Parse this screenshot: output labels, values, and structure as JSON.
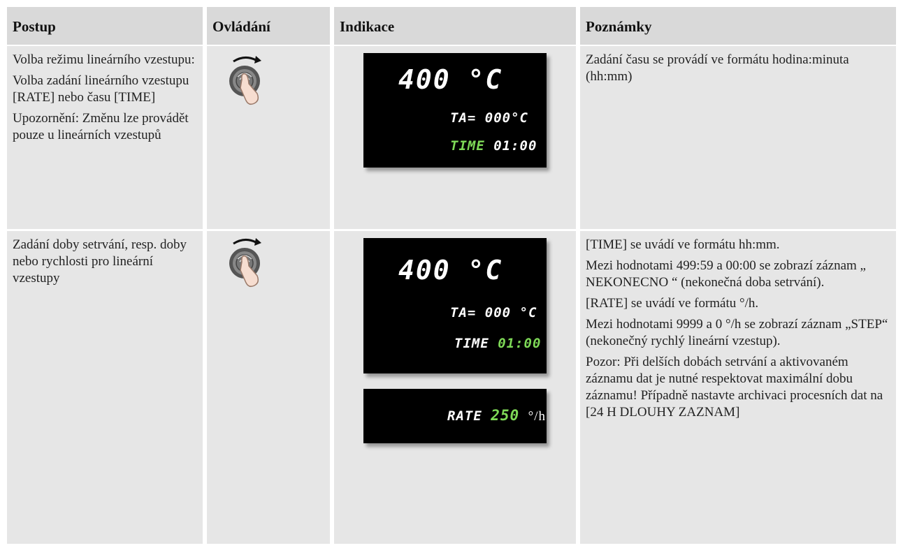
{
  "headers": [
    "Postup",
    "Ovládání",
    "Indikace",
    "Poznámky"
  ],
  "row1": {
    "procedure": [
      "Volba režimu lineárního vzestupu:",
      "Volba zadání lineárního vzestupu [RATE] nebo času [TIME]",
      "Upozornění: Změnu lze provádět pouze u lineárních vzestupů"
    ],
    "control_icon": "rotary-knob-turn-icon",
    "display": {
      "temp": "400",
      "temp_unit": "°C",
      "ta_label": "TA=",
      "ta_value": "000°C",
      "time_label": "TIME",
      "time_value": "01:00"
    },
    "notes": [
      "Zadání času se provádí ve formátu hodina:minuta (hh:mm)"
    ]
  },
  "row2": {
    "procedure": [
      "Zadání doby setrvání, resp. doby nebo rychlosti pro lineární vzestupy"
    ],
    "control_icon": "rotary-knob-turn-icon",
    "display": {
      "temp": "400",
      "temp_unit": "°C",
      "ta_label": "TA=",
      "ta_value": "000 °C",
      "time_label": "TIME",
      "time_value": "01:00"
    },
    "display_rate": {
      "rate_label": "RATE",
      "rate_value": "250",
      "rate_unit": "°/h"
    },
    "notes": [
      "[TIME] se uvádí ve formátu hh:mm.",
      "Mezi hodnotami 499:59 a 00:00 se zobrazí záznam „ NEKONECNO “ (nekonečná doba setrvání).",
      "[RATE] se uvádí ve formátu °/h.",
      "Mezi hodnotami 9999 a 0 °/h se zobrazí záznam „STEP“ (nekonečný rychlý lineární vzestup).",
      "Pozor: Při delších dobách setrvání a aktivovaném záznamu dat je nutné respektovat maximální dobu záznamu! Případně nastavte archivaci procesních dat na [24 H DLOUHY ZAZNAM]"
    ]
  },
  "colors": {
    "header_bg": "#d9d9d9",
    "cell_bg": "#e6e6e6",
    "display_bg": "#000000",
    "display_accent": "#7ed957"
  }
}
